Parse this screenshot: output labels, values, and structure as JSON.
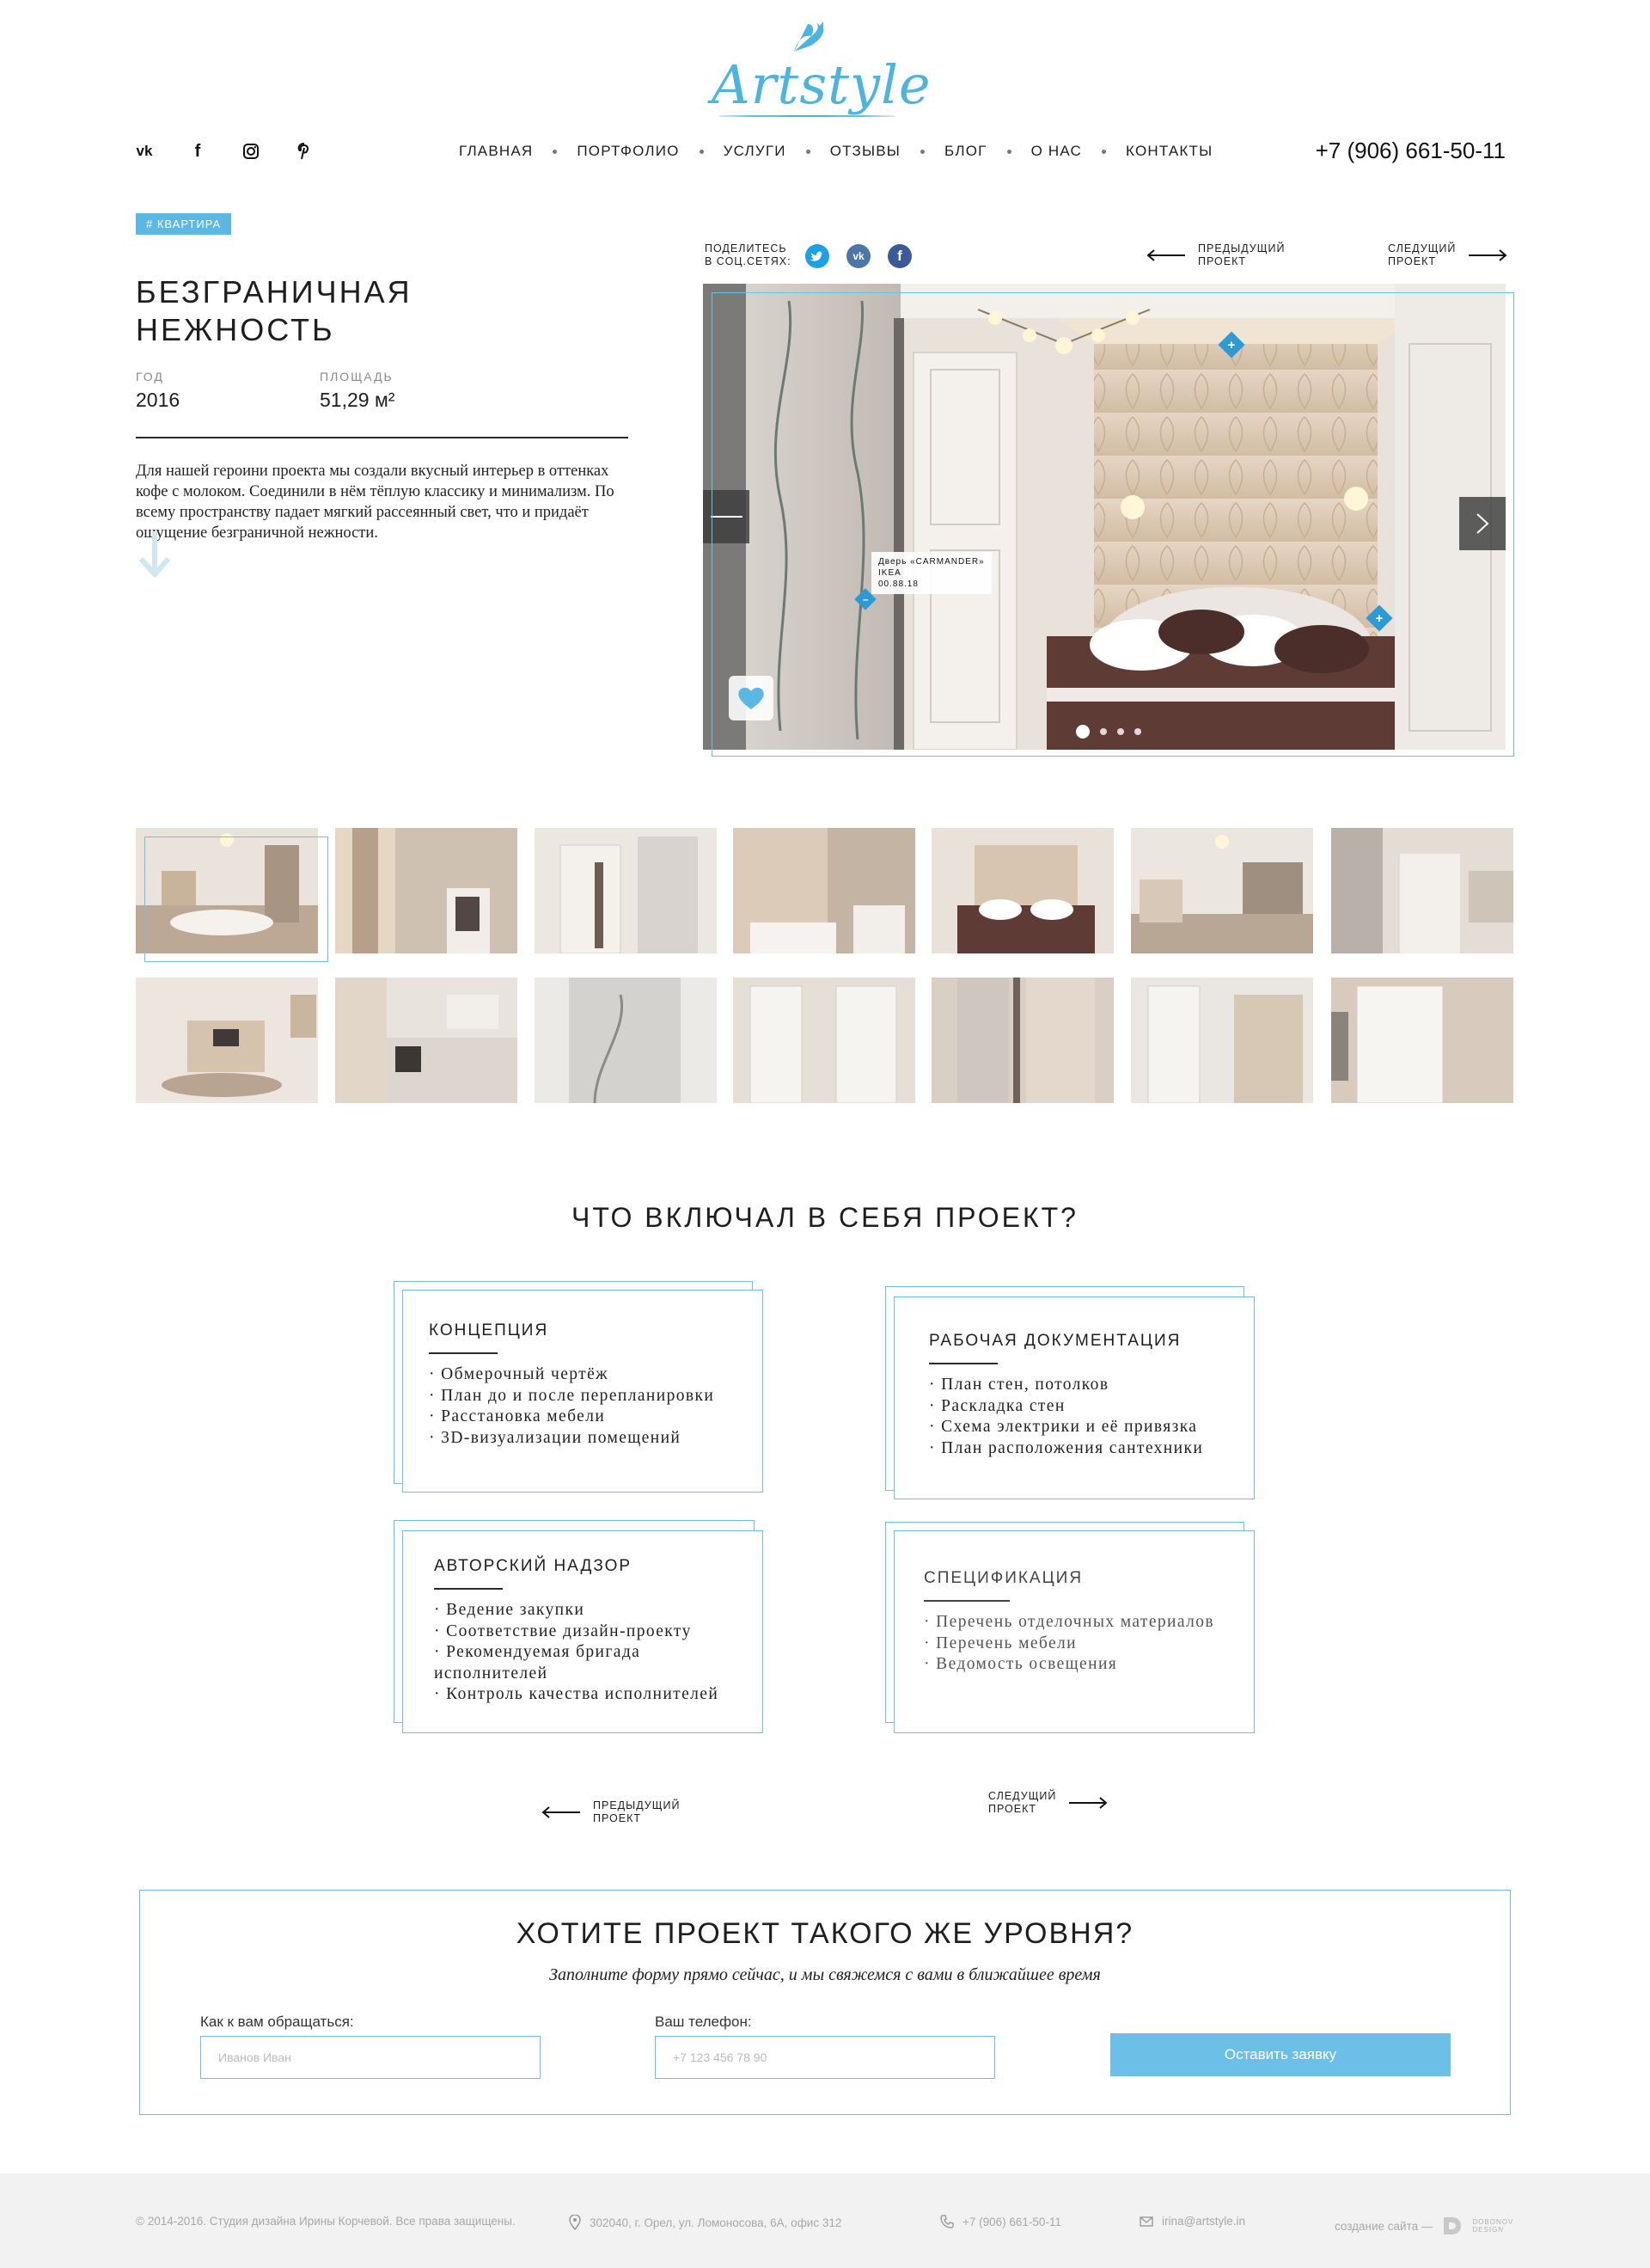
{
  "header": {
    "logo_text": "Artstyle",
    "social_icons": [
      "vk-icon",
      "facebook-icon",
      "instagram-icon",
      "pinterest-icon"
    ],
    "nav": [
      "Главная",
      "Портфолио",
      "Услуги",
      "Отзывы",
      "Блог",
      "О нас",
      "Контакты"
    ],
    "phone": "+7 (906) 661-50-11"
  },
  "project": {
    "tag": "# Квартира",
    "title": "Безграничная нежность",
    "year_label": "Год",
    "year": "2016",
    "area_label": "Площадь",
    "area": "51,29 м²",
    "description": "Для нашей героини проекта мы создали вкусный интерьер в оттенках кофе с молоком. Соединили в нём тёплую классику и минимализм. По всему пространству падает мягкий рассеянный свет, что и придаёт ощущение безграничной нежности."
  },
  "gallery": {
    "share_label_1": "Поделитесь",
    "share_label_2": "в соц.сетях:",
    "share_icons": [
      "twitter-icon",
      "vk-icon",
      "facebook-icon"
    ],
    "prev_1": "Предыдущий",
    "prev_2": "проект",
    "next_1": "Следущий",
    "next_2": "проект",
    "tooltip_line_1": "Дверь «CARMANDER»",
    "tooltip_line_2": "IKEA",
    "tooltip_line_3": "00.88.18",
    "active_dot": 1,
    "dot_count": 4
  },
  "includes": {
    "title": "Что включал в себя проект?",
    "blocks": [
      {
        "title": "Концепция",
        "items": [
          "· Обмерочный чертёж",
          "· План до и после перепланировки",
          "· Расстановка мебели",
          "· 3D-визуализации помещений"
        ]
      },
      {
        "title": "Рабочая документация",
        "items": [
          "· План стен, потолков",
          "· Раскладка стен",
          "· Схема электрики и её привязка",
          "· План расположения сантехники"
        ]
      },
      {
        "title": "Авторский надзор",
        "items": [
          "· Ведение закупки",
          "· Соответствие дизайн-проекту",
          "· Рекомендуемая бригада",
          "исполнителей",
          "· Контроль качества исполнителей"
        ]
      },
      {
        "title": "Спецификация",
        "items": [
          "· Перечень отделочных материалов",
          "· Перечень мебели",
          "· Ведомость освещения"
        ]
      }
    ],
    "prev_1": "Предыдущий",
    "prev_2": "проект",
    "next_1": "Следущий",
    "next_2": "проект"
  },
  "form": {
    "title": "Хотите проект такого же уровня?",
    "subtitle": "Заполните форму прямо сейчас, и мы свяжемся с вами в ближайшее время",
    "name_label": "Как к вам обращаться:",
    "name_placeholder": "Иванов Иван",
    "phone_label": "Ваш телефон:",
    "phone_placeholder": "+7 123 456 78 90",
    "submit": "Оставить заявку"
  },
  "footer": {
    "copyright": "© 2014-2016. Студия дизайна Ирины Корчевой. Все права защищены.",
    "address": "302040, г. Орел, ул. Ломоносова, 6А, офис 312",
    "phone": "+7 (906) 661-50-11",
    "email": "irina@artstyle.in",
    "credit": "создание сайта —",
    "credit_logo_1": "DOBONOV",
    "credit_logo_2": "DESIGN"
  },
  "colors": {
    "accent": "#6cc0e8",
    "tag": "#5bb7e4",
    "hotspot": "#2d9ad6"
  }
}
